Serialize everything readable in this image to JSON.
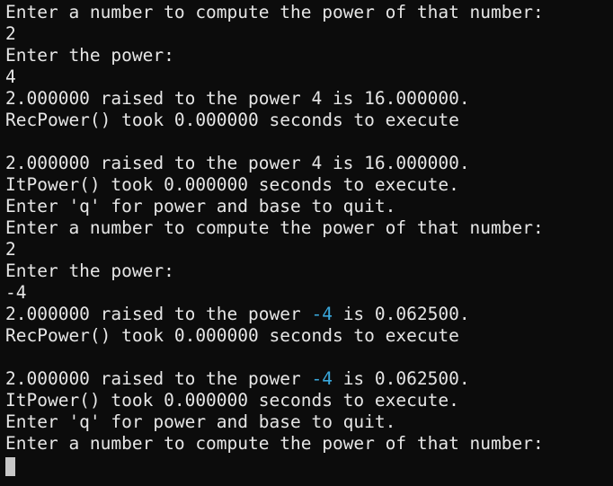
{
  "terminal": {
    "colors": {
      "background": "#0c0c0c",
      "text": "#e6e6e6",
      "highlight": "#3aa8dc",
      "cursor": "#c8c8c8"
    },
    "lines": [
      {
        "text": "Enter a number to compute the power of that number:"
      },
      {
        "text": "2"
      },
      {
        "text": "Enter the power:"
      },
      {
        "text": "4"
      },
      {
        "text": "2.000000 raised to the power 4 is 16.000000."
      },
      {
        "text": "RecPower() took 0.000000 seconds to execute"
      },
      {
        "text": ""
      },
      {
        "text": "2.000000 raised to the power 4 is 16.000000."
      },
      {
        "text": "ItPower() took 0.000000 seconds to execute."
      },
      {
        "text": "Enter 'q' for power and base to quit."
      },
      {
        "text": "Enter a number to compute the power of that number:"
      },
      {
        "text": "2"
      },
      {
        "text": "Enter the power:"
      },
      {
        "text": "-4"
      },
      {
        "pre": "2.000000 raised to the power ",
        "hl": "-4",
        "post": " is 0.062500."
      },
      {
        "text": "RecPower() took 0.000000 seconds to execute"
      },
      {
        "text": ""
      },
      {
        "pre": "2.000000 raised to the power ",
        "hl": "-4",
        "post": " is 0.062500."
      },
      {
        "text": "ItPower() took 0.000000 seconds to execute."
      },
      {
        "text": "Enter 'q' for power and base to quit."
      },
      {
        "text": "Enter a number to compute the power of that number:"
      }
    ]
  }
}
